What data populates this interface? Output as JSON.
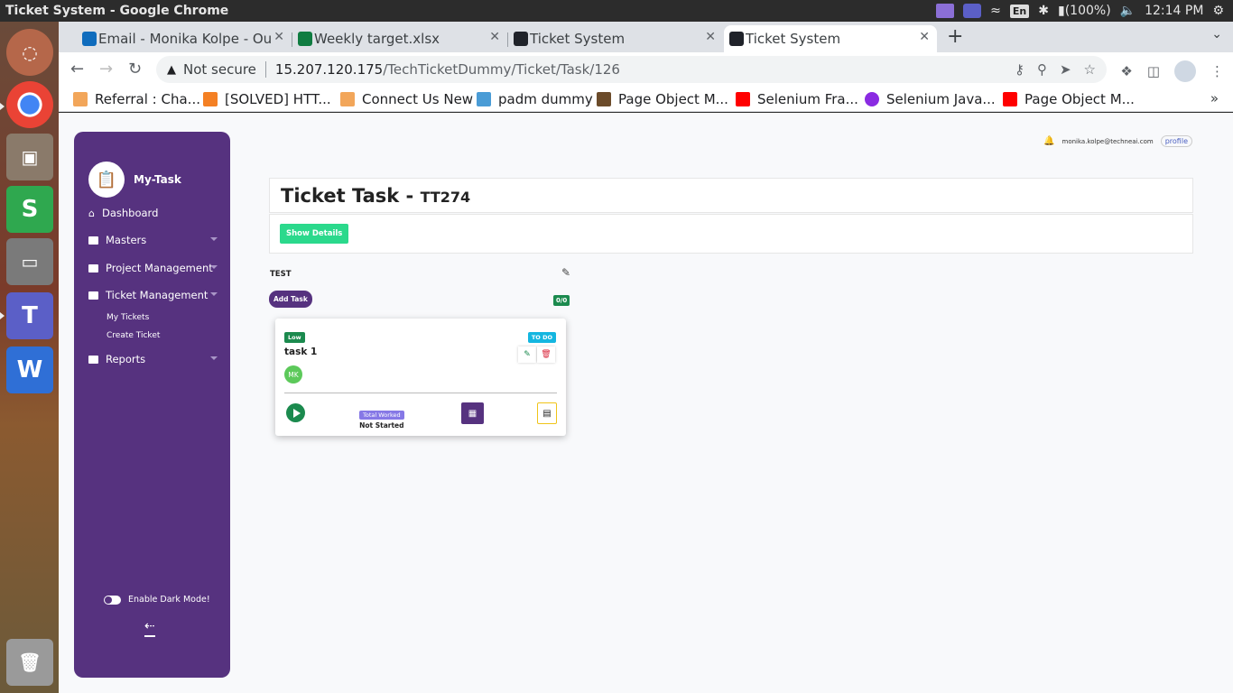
{
  "os": {
    "window_title": "Ticket System - Google Chrome",
    "battery": "(100%)",
    "clock": "12:14 PM",
    "lang": "En"
  },
  "browser": {
    "tabs": [
      {
        "label": "Email - Monika Kolpe - Ou",
        "icon": "outlook-icon",
        "color": "#0f6cbd"
      },
      {
        "label": "Weekly target.xlsx",
        "icon": "excel-icon",
        "color": "#107c41"
      },
      {
        "label": "Ticket System",
        "icon": "react-icon",
        "color": "#20232a"
      },
      {
        "label": "Ticket System",
        "icon": "react-icon",
        "color": "#20232a"
      }
    ],
    "omnibox": {
      "security": "Not secure",
      "host": "15.207.120.175",
      "path": "/TechTicketDummy/Ticket/Task/126"
    },
    "bookmarks": [
      {
        "label": "Referral : Cha...",
        "color": "#f2a65a"
      },
      {
        "label": "[SOLVED] HTT...",
        "color": "#f48024"
      },
      {
        "label": "Connect Us New",
        "color": "#f2a65a"
      },
      {
        "label": "padm dummy",
        "color": "#4a9cd6"
      },
      {
        "label": "Page Object M...",
        "color": "#6b4b2a"
      },
      {
        "label": "Selenium Fra...",
        "color": "#ff0000"
      },
      {
        "label": "Selenium Java...",
        "color": "#8a2be2"
      },
      {
        "label": "Page Object M...",
        "color": "#ff0000"
      }
    ]
  },
  "app": {
    "brand": "My-Task",
    "menu": [
      {
        "label": "Dashboard"
      },
      {
        "label": "Masters"
      },
      {
        "label": "Project Management"
      },
      {
        "label": "Ticket Management"
      },
      {
        "label": "Reports"
      }
    ],
    "submenu": [
      {
        "label": "My Tickets"
      },
      {
        "label": "Create Ticket"
      }
    ],
    "dark_mode_label": "Enable Dark Mode!",
    "user_email": "monika.kolpe@techneai.com",
    "profile_alt": "profile",
    "page_title": "Ticket Task - ",
    "ticket_code": "TT274",
    "show_details": "Show Details",
    "column": {
      "title": "TEST",
      "add_task": "Add Task",
      "count": "0/0"
    },
    "task": {
      "priority": "Low",
      "status": "TO DO",
      "name": "task 1",
      "assignee_initials": "MK",
      "worked_label": "Total Worked",
      "worked_value": "Not Started"
    },
    "colors": {
      "sidebar": "#56327f",
      "show_details": "#2bd98c",
      "priority_low": "#1b8a4e",
      "status_todo": "#14b6e0"
    }
  }
}
